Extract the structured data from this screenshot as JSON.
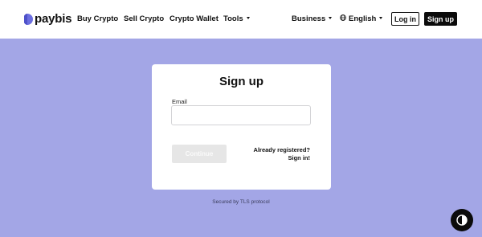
{
  "brand": {
    "name": "paybis",
    "accent": "#6c6fe0",
    "background": "#a3a6e6"
  },
  "nav": {
    "buy": "Buy Crypto",
    "sell": "Sell Crypto",
    "wallet": "Crypto Wallet",
    "tools": "Tools",
    "business": "Business",
    "language": "English"
  },
  "auth": {
    "login": "Log in",
    "signup": "Sign up"
  },
  "card": {
    "title": "Sign up",
    "email_label": "Email",
    "email_value": "",
    "email_placeholder": "",
    "continue": "Continue",
    "already": "Already registered?",
    "signin": "Sign in!"
  },
  "footer": {
    "secured": "Secured by TLS protocol"
  },
  "icons": {
    "logo": "paybis-logo-icon",
    "language": "globe-icon",
    "theme": "contrast-icon"
  }
}
